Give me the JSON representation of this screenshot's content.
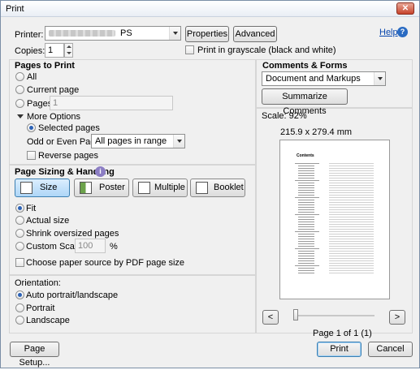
{
  "window": {
    "title": "Print"
  },
  "printer": {
    "label": "Printer:",
    "value_suffix": "PS",
    "properties_label": "Properties",
    "advanced_label": "Advanced",
    "help_label": "Help"
  },
  "copies": {
    "label": "Copies:",
    "value": "1"
  },
  "grayscale": {
    "label": "Print in grayscale (black and white)"
  },
  "pages_to_print": {
    "title": "Pages to Print",
    "all": "All",
    "current": "Current page",
    "pages": "Pages",
    "pages_value": "1",
    "more_options": "More Options",
    "selected_pages": "Selected pages",
    "odd_even_label": "Odd or Even Pages:",
    "odd_even_value": "All pages in range",
    "reverse": "Reverse pages"
  },
  "sizing": {
    "title": "Page Sizing & Handling",
    "buttons": [
      "Size",
      "Poster",
      "Multiple",
      "Booklet"
    ],
    "fit": "Fit",
    "actual": "Actual size",
    "shrink": "Shrink oversized pages",
    "custom": "Custom Scale:",
    "custom_value": "100",
    "percent": "%",
    "paper_source": "Choose paper source by PDF page size"
  },
  "orientation": {
    "title": "Orientation:",
    "auto": "Auto portrait/landscape",
    "portrait": "Portrait",
    "landscape": "Landscape"
  },
  "comments": {
    "title": "Comments & Forms",
    "value": "Document and Markups",
    "summarize": "Summarize Comments"
  },
  "preview": {
    "scale": "Scale:  92%",
    "dimensions": "215.9 x 279.4 mm",
    "page_title": "Contents",
    "page_of": "Page 1 of 1 (1)",
    "prev": "<",
    "next": ">"
  },
  "footer": {
    "page_setup": "Page Setup...",
    "print": "Print",
    "cancel": "Cancel"
  }
}
